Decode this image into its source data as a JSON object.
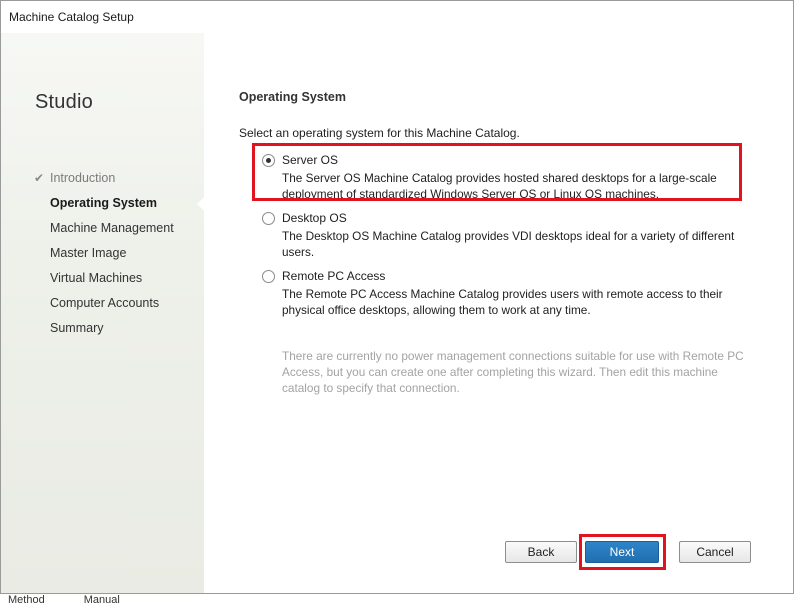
{
  "window": {
    "title": "Machine Catalog Setup"
  },
  "sidebar": {
    "brand": "Studio",
    "steps": [
      {
        "label": "Introduction",
        "state": "completed",
        "check_icon": "checkmark-icon"
      },
      {
        "label": "Operating System",
        "state": "current"
      },
      {
        "label": "Machine Management",
        "state": "pending"
      },
      {
        "label": "Master Image",
        "state": "pending"
      },
      {
        "label": "Virtual Machines",
        "state": "pending"
      },
      {
        "label": "Computer Accounts",
        "state": "pending"
      },
      {
        "label": "Summary",
        "state": "pending"
      }
    ]
  },
  "main": {
    "section_title": "Operating System",
    "instruction": "Select an operating system for this Machine Catalog.",
    "options": [
      {
        "label": "Server OS",
        "description": "The Server OS Machine Catalog provides hosted shared desktops for a large-scale deployment of standardized Windows Server OS or Linux OS machines.",
        "selected": true
      },
      {
        "label": "Desktop OS",
        "description": "The Desktop OS Machine Catalog provides VDI desktops ideal for a variety of different users.",
        "selected": false
      },
      {
        "label": "Remote PC Access",
        "description": "The Remote PC Access Machine Catalog provides users with remote access to their physical office desktops, allowing them to work at any time.",
        "selected": false
      }
    ],
    "note": "There are currently no power management connections suitable for use with Remote PC Access, but you can create one after completing this wizard. Then edit this machine catalog to specify that connection."
  },
  "buttons": {
    "back": "Back",
    "next": "Next",
    "cancel": "Cancel"
  },
  "colors": {
    "highlight": "#e0141e",
    "primary_button": "#2278be",
    "note_text": "#a3a3a3"
  },
  "footer": {
    "text1": "Method",
    "text2": "Manual"
  }
}
